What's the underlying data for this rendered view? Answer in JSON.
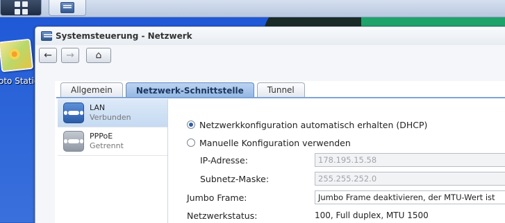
{
  "desktop": {
    "icon_label": "oto Statio"
  },
  "window": {
    "title": "Systemsteuerung - Netzwerk"
  },
  "nav": {
    "back": "←",
    "forward": "→",
    "home": "⌂"
  },
  "tabs": [
    {
      "label": "Allgemein",
      "active": false
    },
    {
      "label": "Netzwerk-Schnittstelle",
      "active": true
    },
    {
      "label": "Tunnel",
      "active": false
    }
  ],
  "interfaces": [
    {
      "name": "LAN",
      "status": "Verbunden",
      "selected": true
    },
    {
      "name": "PPPoE",
      "status": "Getrennt",
      "selected": false
    }
  ],
  "form": {
    "dhcp_label": "Netzwerkkonfiguration automatisch erhalten (DHCP)",
    "dhcp_checked": true,
    "manual_label": "Manuelle Konfiguration verwenden",
    "manual_checked": false,
    "ip_label": "IP-Adresse:",
    "ip_value": "178.195.15.58",
    "subnet_label": "Subnetz-Maske:",
    "subnet_value": "255.255.252.0",
    "jumbo_label": "Jumbo Frame:",
    "jumbo_value": "Jumbo Frame deaktivieren, der MTU-Wert ist",
    "status_label": "Netzwerkstatus:",
    "status_value": "100, Full duplex, MTU 1500"
  },
  "colors": {
    "desktop": "#2a63d8",
    "active_tab": "#93b6e3",
    "selected_item": "#c5daf2"
  }
}
